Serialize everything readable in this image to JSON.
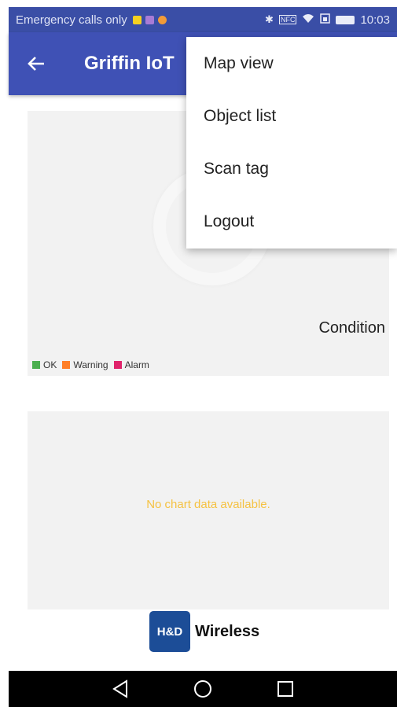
{
  "status_bar": {
    "carrier": "Emergency calls only",
    "time": "10:03",
    "nfc": "NFC",
    "icon_colors": [
      "#f5d020",
      "#a77bd6",
      "#f29b38"
    ]
  },
  "app_bar": {
    "title": "Griffin IoT",
    "back_icon": "arrow-left-icon"
  },
  "menu": {
    "items": [
      "Map view",
      "Object list",
      "Scan tag",
      "Logout"
    ]
  },
  "condition_card": {
    "label": "Condition",
    "legend": [
      {
        "label": "OK",
        "color": "#4caf50"
      },
      {
        "label": "Warning",
        "color": "#ff7f27"
      },
      {
        "label": "Alarm",
        "color": "#e0246b"
      }
    ]
  },
  "chart_card": {
    "empty_text": "No chart data available.",
    "empty_color": "#f5c242"
  },
  "footer": {
    "logo_mark": "H&D",
    "logo_text": "Wireless"
  },
  "nav_bar": {
    "icons": [
      "back-triangle-icon",
      "home-circle-icon",
      "recents-square-icon"
    ]
  }
}
